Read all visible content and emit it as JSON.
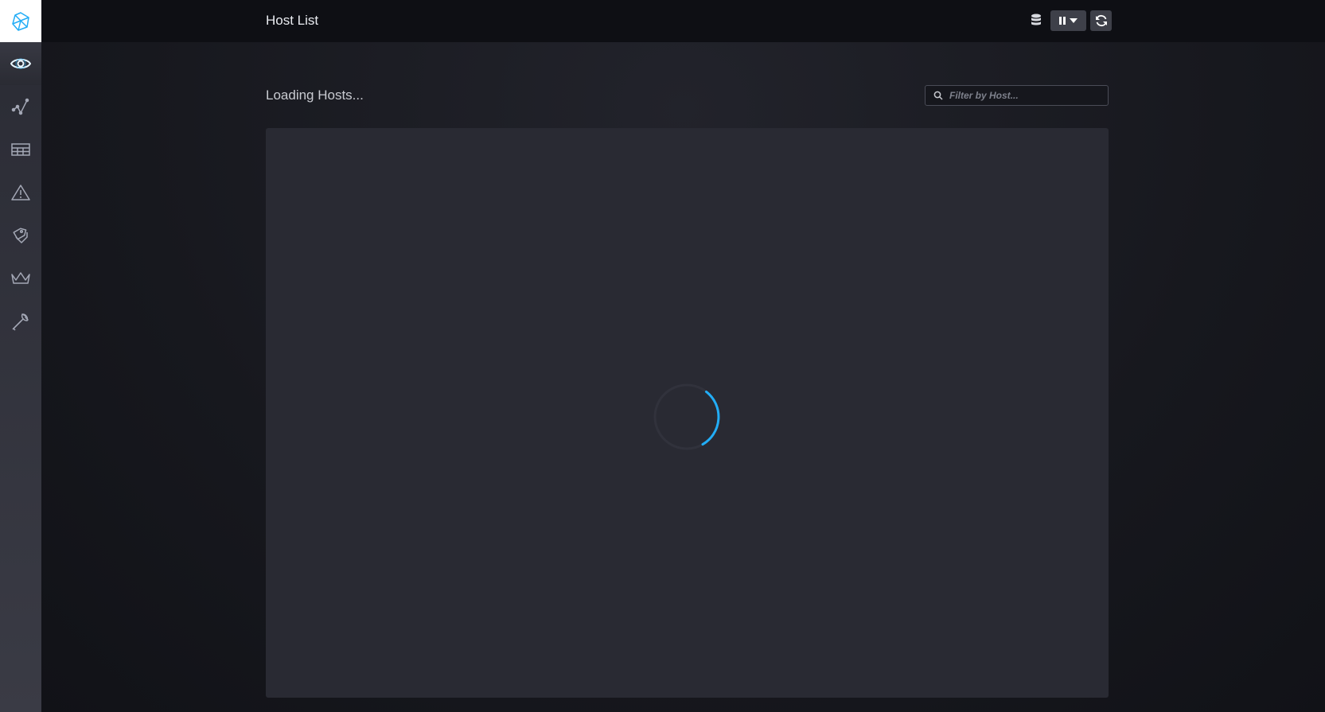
{
  "header": {
    "title": "Host List"
  },
  "main": {
    "loading_text": "Loading Hosts...",
    "filter": {
      "placeholder": "Filter by Host...",
      "value": ""
    }
  },
  "sidebar": {
    "items": [
      {
        "name": "host-list",
        "icon": "eye-icon",
        "active": true
      },
      {
        "name": "data-explorer",
        "icon": "graph-icon",
        "active": false
      },
      {
        "name": "dashboards",
        "icon": "table-icon",
        "active": false
      },
      {
        "name": "alerting",
        "icon": "alert-triangle-icon",
        "active": false
      },
      {
        "name": "log-viewer",
        "icon": "tags-icon",
        "active": false
      },
      {
        "name": "admin",
        "icon": "crown-icon",
        "active": false
      },
      {
        "name": "configuration",
        "icon": "wrench-icon",
        "active": false
      }
    ]
  },
  "colors": {
    "accent": "#22adf6",
    "sidebar": "#35363f",
    "topbar": "#0e0f14",
    "panel": "#292a33"
  }
}
